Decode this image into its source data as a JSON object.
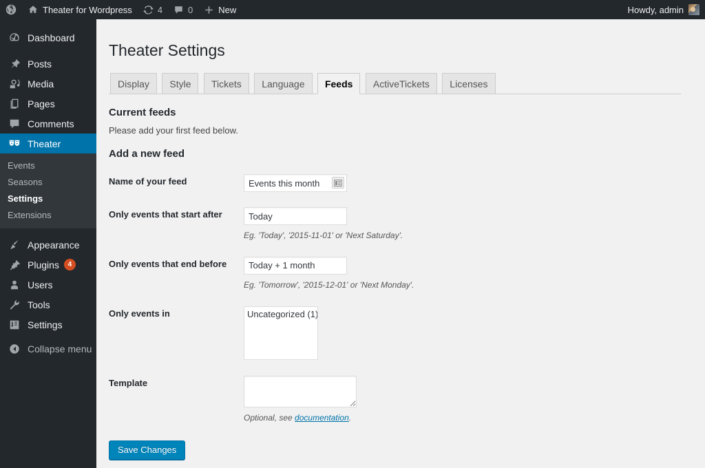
{
  "adminbar": {
    "site_name": "Theater for Wordpress",
    "updates_count": "4",
    "comments_count": "0",
    "new_label": "New",
    "howdy": "Howdy, admin"
  },
  "sidebar": {
    "items": [
      {
        "label": "Dashboard",
        "icon": "dashboard-icon",
        "name": "dashboard"
      },
      {
        "label": "Posts",
        "icon": "pin-icon",
        "name": "posts"
      },
      {
        "label": "Media",
        "icon": "media-icon",
        "name": "media"
      },
      {
        "label": "Pages",
        "icon": "pages-icon",
        "name": "pages"
      },
      {
        "label": "Comments",
        "icon": "comments-icon",
        "name": "comments"
      },
      {
        "label": "Theater",
        "icon": "masks-icon",
        "name": "theater"
      },
      {
        "label": "Appearance",
        "icon": "brush-icon",
        "name": "appearance"
      },
      {
        "label": "Plugins",
        "icon": "plug-icon",
        "name": "plugins",
        "badge": "4"
      },
      {
        "label": "Users",
        "icon": "user-icon",
        "name": "users"
      },
      {
        "label": "Tools",
        "icon": "wrench-icon",
        "name": "tools"
      },
      {
        "label": "Settings",
        "icon": "sliders-icon",
        "name": "settings"
      },
      {
        "label": "Collapse menu",
        "icon": "collapse-icon",
        "name": "collapse"
      }
    ],
    "theater_submenu": [
      {
        "label": "Events",
        "current": false
      },
      {
        "label": "Seasons",
        "current": false
      },
      {
        "label": "Settings",
        "current": true
      },
      {
        "label": "Extensions",
        "current": false
      }
    ]
  },
  "page": {
    "title": "Theater Settings",
    "tabs": [
      {
        "label": "Display",
        "active": false
      },
      {
        "label": "Style",
        "active": false
      },
      {
        "label": "Tickets",
        "active": false
      },
      {
        "label": "Language",
        "active": false
      },
      {
        "label": "Feeds",
        "active": true
      },
      {
        "label": "ActiveTickets",
        "active": false
      },
      {
        "label": "Licenses",
        "active": false
      }
    ],
    "current_feeds_title": "Current feeds",
    "current_feeds_note": "Please add your first feed below.",
    "add_feed_title": "Add a new feed",
    "fields": {
      "name_label": "Name of your feed",
      "name_value": "Events this month",
      "start_label": "Only events that start after",
      "start_value": "Today",
      "start_help": "Eg. 'Today', '2015-11-01' or 'Next Saturday'.",
      "end_label": "Only events that end before",
      "end_value": "Today + 1 month",
      "end_help": "Eg. 'Tomorrow', '2015-12-01' or 'Next Monday'.",
      "categories_label": "Only events in",
      "categories_options": [
        "Uncategorized (1)"
      ],
      "template_label": "Template",
      "template_value": "",
      "template_help_before": "Optional, see ",
      "template_help_link": "documentation",
      "template_help_after": "."
    },
    "save_label": "Save Changes"
  },
  "colors": {
    "admin_bar": "#23282d",
    "sidebar": "#23282d",
    "submenu": "#32373c",
    "accent": "#0073aa",
    "button": "#0085ba",
    "badge": "#d54e21",
    "content_bg": "#f1f1f1"
  }
}
